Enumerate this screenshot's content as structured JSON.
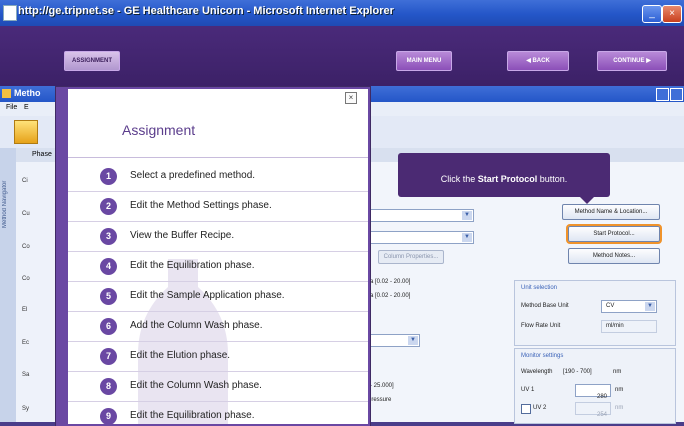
{
  "browser": {
    "title": "http://ge.tripnet.se - GE Healthcare Unicorn - Microsoft Internet Explorer"
  },
  "nav": {
    "assignment_label": "ASSIGNMENT",
    "main_menu_label": "MAIN MENU",
    "back_label": "◀  BACK",
    "continue_label": "CONTINUE  ▶"
  },
  "inner_window": {
    "title": "Metho",
    "menu": [
      "File",
      "E"
    ],
    "tab": "Phase",
    "side_label": "Method Navigator",
    "left_stubs": [
      "Ci",
      "Cu",
      "Co",
      "Co",
      "El",
      "Ec",
      "Sa",
      "Sy"
    ]
  },
  "form": {
    "column_properties_label": "Column Properties...",
    "unit_lbl": "l",
    "pressure_1": "Pa [0.02 - 20.00]",
    "pressure_2": "Pa [0.02 - 20.00]",
    "range_flow": "- 25.000]",
    "pressure_note": "pressure",
    "method_name_location": "Method Name & Location...",
    "start_protocol": "Start Protocol...",
    "method_notes": "Method Notes...",
    "unit_selection": {
      "title": "Unit selection",
      "method_base_label": "Method Base Unit",
      "method_base_value": "CV",
      "flow_rate_label": "Flow Rate Unit",
      "flow_rate_value": "ml/min"
    },
    "monitor_settings": {
      "title": "Monitor settings",
      "wavelength_label": "Wavelength",
      "wavelength_range": "[190 - 700]",
      "wavelength_unit": "nm",
      "uv1_label": "UV 1",
      "uv1_value": "280",
      "uv1_unit": "nm",
      "uv2_label": "UV 2",
      "uv2_value": "254",
      "uv2_unit": "nm"
    }
  },
  "tooltip": {
    "pre": "Click the ",
    "bold": "Start Protocol",
    "post": " button."
  },
  "dialog": {
    "title": "Assignment",
    "steps": [
      {
        "num": "1",
        "text": "Select a predefined method."
      },
      {
        "num": "2",
        "text": "Edit the Method Settings phase."
      },
      {
        "num": "3",
        "text": "View the Buffer Recipe."
      },
      {
        "num": "4",
        "text": "Edit the Equilibration phase."
      },
      {
        "num": "5",
        "text": "Edit the Sample Application phase."
      },
      {
        "num": "6",
        "text": "Add the Column Wash phase."
      },
      {
        "num": "7",
        "text": "Edit the Elution phase."
      },
      {
        "num": "8",
        "text": "Edit the Column Wash phase."
      },
      {
        "num": "9",
        "text": "Edit the Equilibration phase."
      }
    ]
  },
  "colors": {
    "purple_dark": "#4a2a7a",
    "dialog_accent": "#6a48a3",
    "highlight_outline": "#f0932b",
    "ie_blue": "#2456c8"
  }
}
